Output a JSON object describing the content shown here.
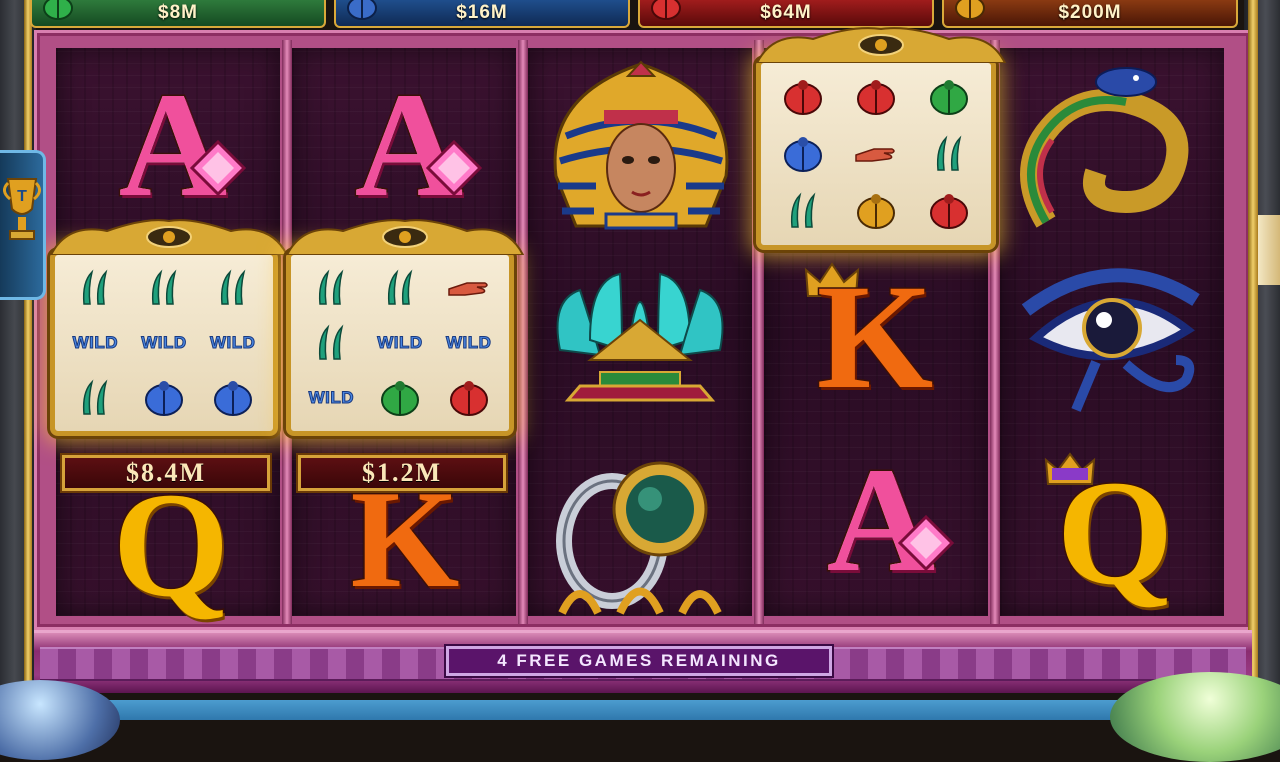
{
  "jackpots": [
    {
      "amount": "$8M",
      "color": "#1c5a2c"
    },
    {
      "amount": "$16M",
      "color": "#173a6a"
    },
    {
      "amount": "$64M",
      "color": "#7a1414"
    },
    {
      "amount": "$200M",
      "color": "#5a1a10"
    }
  ],
  "mini_reels": [
    {
      "value": "$8.4M",
      "cells": [
        "feather",
        "feather",
        "feather",
        "WILD",
        "WILD",
        "WILD",
        "feather",
        "scarab-blue",
        "scarab-blue"
      ]
    },
    {
      "value": "$1.2M",
      "cells": [
        "feather",
        "feather",
        "hand",
        "feather",
        "WILD",
        "WILD",
        "WILD",
        "scarab-green",
        "scarab-red"
      ]
    },
    {
      "value": "",
      "cells": [
        "scarab-red",
        "scarab-red",
        "scarab-green",
        "scarab-blue",
        "hand",
        "feather",
        "feather",
        "scarab-gold",
        "scarab-red"
      ]
    }
  ],
  "letters": {
    "a": "A",
    "k": "K",
    "q": "Q"
  },
  "status": {
    "free_games": "4 FREE GAMES REMAINING"
  },
  "colors": {
    "frame_pink": "#b14f86",
    "gold": "#d9a93a",
    "reel_bg": "#2a0c24"
  }
}
